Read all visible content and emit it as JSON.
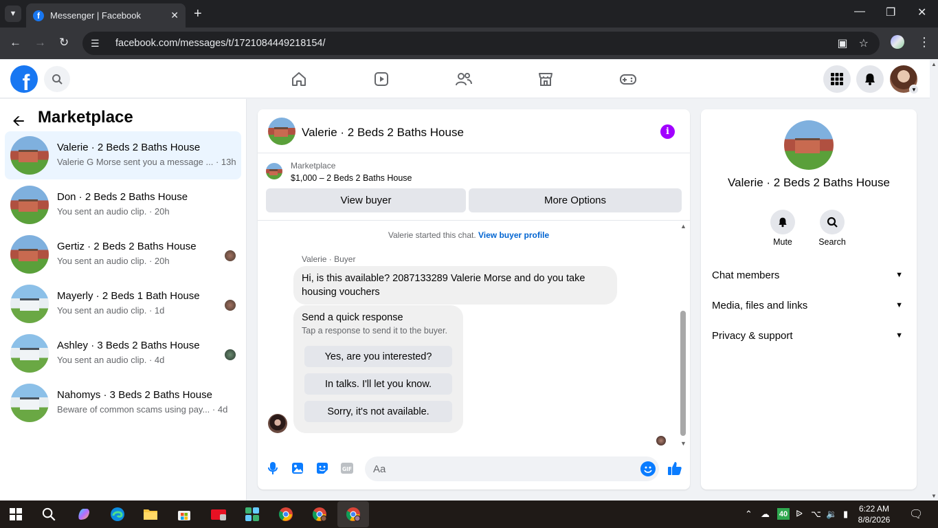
{
  "browser": {
    "tab_title": "Messenger | Facebook",
    "url": "facebook.com/messages/t/1721084449218154/"
  },
  "sidebar": {
    "title": "Marketplace",
    "conversations": [
      {
        "name": "Valerie · 2 Beds 2 Baths House",
        "snippet": "Valerie G Morse sent you a message ... · 13h",
        "active": true
      },
      {
        "name": "Don · 2 Beds 2 Baths House",
        "snippet": "You sent an audio clip. · 20h"
      },
      {
        "name": "Gertiz · 2 Beds 2 Baths House",
        "snippet": "You sent an audio clip. · 20h"
      },
      {
        "name": "Mayerly · 2 Beds 1 Bath House",
        "snippet": "You sent an audio clip. · 1d"
      },
      {
        "name": "Ashley · 3 Beds 2 Baths House",
        "snippet": "You sent an audio clip. · 4d"
      },
      {
        "name": "Nahomys · 3 Beds 2 Baths House",
        "snippet": "Beware of common scams using pay... · 4d"
      }
    ]
  },
  "chat": {
    "title": "Valerie · 2 Beds 2 Baths House",
    "marketplace_label": "Marketplace",
    "listing": "$1,000 – 2 Beds 2 Baths House",
    "view_buyer": "View buyer",
    "more_options": "More Options",
    "started_text": "Valerie started this chat.",
    "view_buyer_profile": "View buyer profile",
    "sender": "Valerie · Buyer",
    "message": "Hi, is this available? 2087133289 Valerie Morse and do you take housing vouchers",
    "quick_title": "Send a quick response",
    "quick_sub": "Tap a response to send it to the buyer.",
    "quick_options": [
      "Yes, are you interested?",
      "In talks. I'll let you know.",
      "Sorry, it's not available."
    ],
    "composer_placeholder": "Aa"
  },
  "right_panel": {
    "title": "Valerie · 2 Beds 2 Baths House",
    "mute": "Mute",
    "search": "Search",
    "sections": [
      "Chat members",
      "Media, files and links",
      "Privacy & support"
    ]
  },
  "taskbar": {
    "time": "6:22 AM",
    "date": "8/8/2026",
    "badge": "40"
  }
}
